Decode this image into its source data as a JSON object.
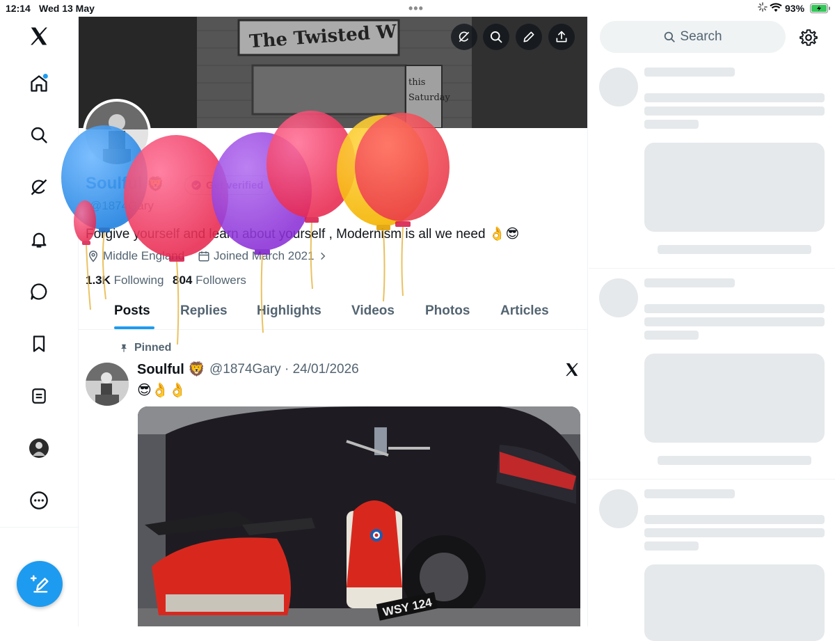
{
  "status_bar": {
    "time": "12:14",
    "date": "Wed 13 May",
    "battery": "93%",
    "accent_battery": "#34c759"
  },
  "nav": {
    "items": [
      "x-logo-icon",
      "home-icon",
      "search-icon",
      "grok-icon",
      "notifications-icon",
      "messages-icon",
      "bookmarks-icon",
      "lists-icon",
      "profile-avatar",
      "more-icon"
    ],
    "compose": "compose-icon",
    "accent": "#1d9bf0"
  },
  "profile": {
    "name": "Soulful",
    "name_emoji": "🦁",
    "verify_label": "Get verified",
    "handle": "@1874Gary",
    "bio": "Forgive yourself and learn about yourself , Modernism is all we need 👌😎",
    "location": "Middle England",
    "joined": "Joined March 2021",
    "following_count": "1.3K",
    "following_label": "Following",
    "followers_count": "804",
    "followers_label": "Followers"
  },
  "tabs": [
    "Posts",
    "Replies",
    "Highlights",
    "Videos",
    "Photos",
    "Articles"
  ],
  "post": {
    "pinned_label": "Pinned",
    "author": "Soulful 🦁",
    "meta": "@1874Gary · 24/01/2026",
    "text": "😎👌👌",
    "plate": "WSY 124"
  },
  "right": {
    "search_placeholder": "Search"
  },
  "banner": {
    "sign_text": "The Twisted W",
    "board_text": "this Saturday"
  }
}
